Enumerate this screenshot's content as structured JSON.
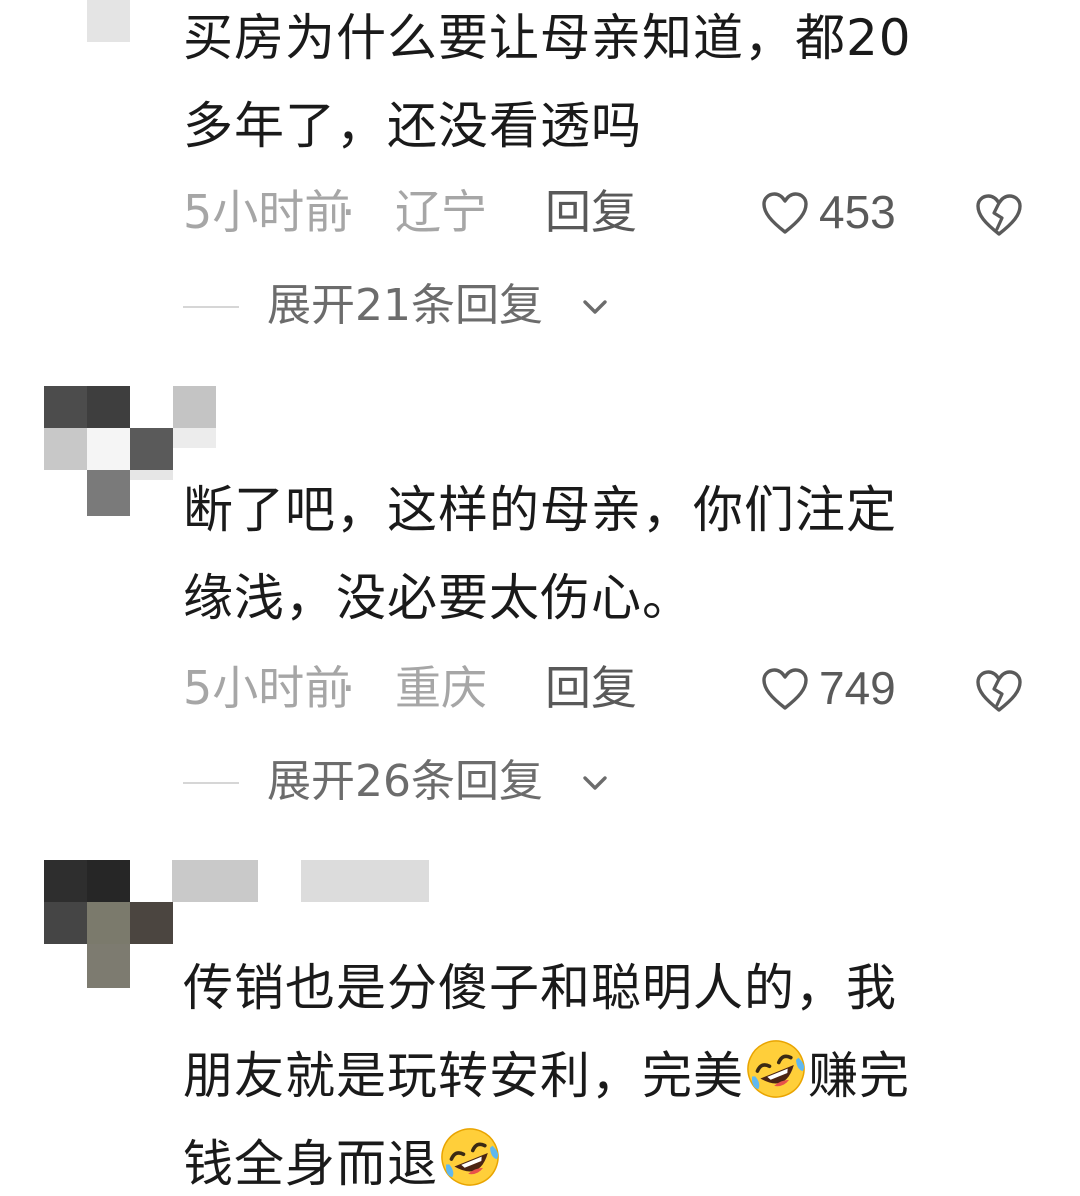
{
  "comments": [
    {
      "text": "买房为什么要让母亲知道，都20多年了，还没看透吗",
      "lines": [
        "买房为什么要让母亲知道，都20",
        "多年了，还没看透吗"
      ],
      "time": "5小时前",
      "separator": "·",
      "region": "辽宁",
      "reply_label": "回复",
      "likes": "453",
      "expand_label": "展开21条回复"
    },
    {
      "text": "断了吧，这样的母亲，你们注定缘浅，没必要太伤心。",
      "lines": [
        "断了吧，这样的母亲，你们注定",
        "缘浅，没必要太伤心。"
      ],
      "time": "5小时前",
      "separator": "·",
      "region": "重庆",
      "reply_label": "回复",
      "likes": "749",
      "expand_label": "展开26条回复"
    },
    {
      "text": "传销也是分傻子和聪明人的，我朋友就是玩转安利，完美🤣赚完钱全身而退🤣",
      "line1": "传销也是分傻子和聪明人的，我",
      "line2_a": "朋友就是玩转安利，完美",
      "line2_b": "赚完",
      "line3_a": "钱全身而退",
      "emoji": "rofl-emoji"
    }
  ],
  "icons": {
    "like": "heart-outline-icon",
    "dislike": "broken-heart-icon",
    "expand": "chevron-down-icon"
  },
  "colors": {
    "text": "#1a1a1a",
    "meta": "#a6a6a6",
    "reply": "#595959",
    "expand": "#6c6c6c"
  }
}
